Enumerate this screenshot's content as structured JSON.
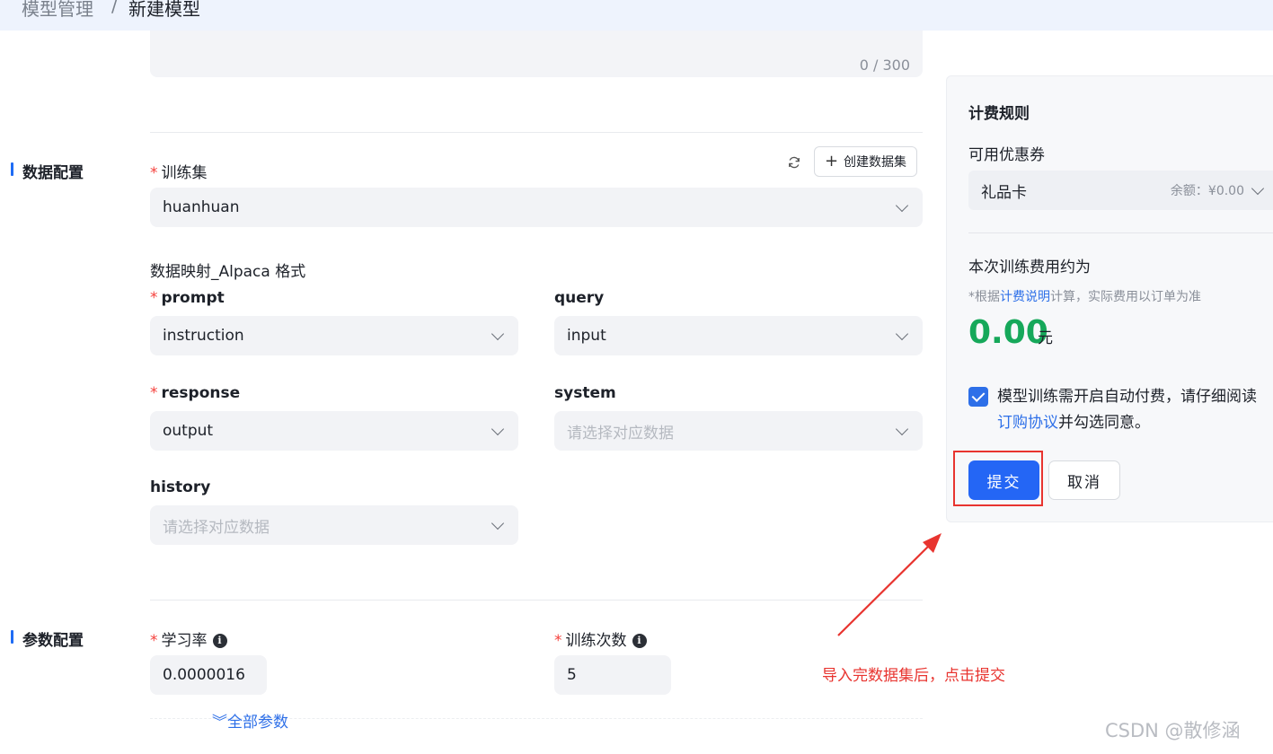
{
  "breadcrumb": {
    "parent": "模型管理",
    "separator": "/",
    "current": "新建模型"
  },
  "description": {
    "counter": "0 / 300"
  },
  "data_config": {
    "section_title": "数据配置",
    "training_set": {
      "label": "训练集",
      "value": "huanhuan"
    },
    "create_dataset_label": "创建数据集",
    "mapping_title": "数据映射_Alpaca 格式",
    "prompt": {
      "label": "prompt",
      "value": "instruction",
      "required": true
    },
    "query": {
      "label": "query",
      "value": "input",
      "required": false
    },
    "response": {
      "label": "response",
      "value": "output",
      "required": true
    },
    "system": {
      "label": "system",
      "placeholder": "请选择对应数据",
      "required": false
    },
    "history": {
      "label": "history",
      "placeholder": "请选择对应数据",
      "required": false
    }
  },
  "param_config": {
    "section_title": "参数配置",
    "learning_rate": {
      "label": "学习率",
      "value": "0.0000016"
    },
    "epochs": {
      "label": "训练次数",
      "value": "5"
    },
    "all_params_label": "全部参数"
  },
  "billing": {
    "title": "计费规则",
    "coupon_label": "可用优惠券",
    "coupon_name": "礼品卡",
    "coupon_balance": "余额：¥0.00",
    "fee_label": "本次训练费用约为",
    "fee_note_prefix": "*根据",
    "fee_note_link": "计费说明",
    "fee_note_suffix": "计算，实际费用以订单为准",
    "price": "0.00",
    "unit": "元",
    "agreement_text": "模型训练需开启自动付费，请仔细阅读",
    "agreement_link": "订购协议",
    "agreement_suffix": "并勾选同意。",
    "agreement_checked": true,
    "submit_label": "提交",
    "cancel_label": "取消"
  },
  "annotation": {
    "text": "导入完数据集后，点击提交"
  },
  "watermark": "CSDN @散修涵",
  "colors": {
    "primary": "#2466f5",
    "price": "#16a85a",
    "annotation": "#e8342f",
    "required": "#f5403c"
  }
}
